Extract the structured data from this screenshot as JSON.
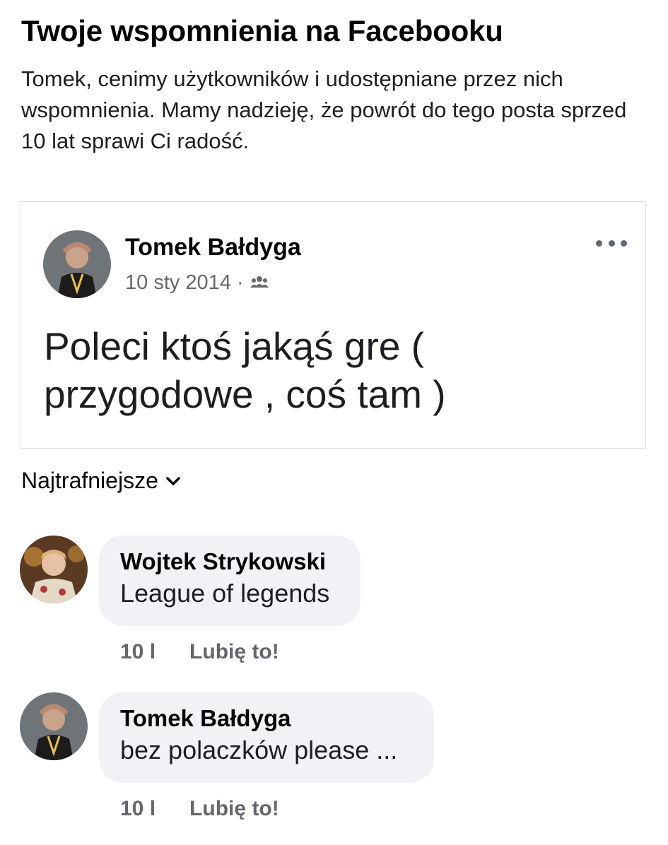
{
  "header": {
    "title": "Twoje wspomnienia na Facebooku",
    "intro": "Tomek, cenimy użytkowników i udostępniane przez nich wspomnienia. Mamy nadzieję, że powrót do tego posta sprzed 10 lat sprawi Ci radość."
  },
  "post": {
    "author": "Tomek Bałdyga",
    "date": "10 sty 2014",
    "separator": "·",
    "audience_icon": "friends-icon",
    "more_icon": "more-dots-icon",
    "text": "Poleci ktoś jakąś gre ( przygodowe , coś tam )"
  },
  "comments_sort": {
    "label": "Najtrafniejsze",
    "icon": "chevron-down-icon"
  },
  "comments": [
    {
      "author": "Wojtek Strykowski",
      "text": "League of legends",
      "time": "10 l",
      "like_label": "Lubię to!"
    },
    {
      "author": "Tomek Bałdyga",
      "text": "bez polaczków please ...",
      "time": "10 l",
      "like_label": "Lubię to!"
    }
  ],
  "colors": {
    "text_primary": "#050505",
    "text_secondary": "#65676b",
    "bubble_bg": "#f0f2f5",
    "card_border": "#dadde1"
  }
}
